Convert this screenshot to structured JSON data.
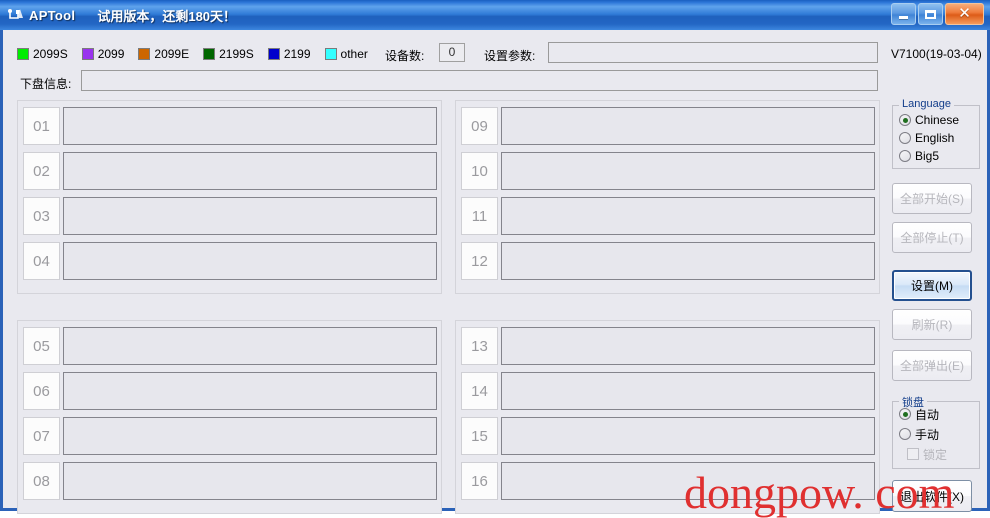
{
  "window": {
    "title": "APTool",
    "subtitle": "试用版本，还剩180天！",
    "icon": "usb-device-icon",
    "buttons": {
      "minimize": "minimize-button",
      "maximize": "maximize-button",
      "close": "close-button"
    }
  },
  "legend": {
    "items": [
      {
        "label": "2099S",
        "color": "#00ee00"
      },
      {
        "label": "2099",
        "color": "#9933ee"
      },
      {
        "label": "2099E",
        "color": "#cc6600"
      },
      {
        "label": "2199S",
        "color": "#006600"
      },
      {
        "label": "2199",
        "color": "#0000cc"
      },
      {
        "label": "other",
        "color": "#33ffff"
      }
    ]
  },
  "toolbar": {
    "device_count_label": "设备数:",
    "device_count_value": "0",
    "params_label": "设置参数:",
    "params_value": "",
    "params_placeholder": "",
    "version": "V7100(19-03-04)"
  },
  "diskinfo": {
    "label": "下盘信息:",
    "value": "",
    "placeholder": ""
  },
  "ports": {
    "top_left": [
      {
        "num": "01",
        "value": ""
      },
      {
        "num": "02",
        "value": ""
      },
      {
        "num": "03",
        "value": ""
      },
      {
        "num": "04",
        "value": ""
      }
    ],
    "top_right": [
      {
        "num": "09",
        "value": ""
      },
      {
        "num": "10",
        "value": ""
      },
      {
        "num": "11",
        "value": ""
      },
      {
        "num": "12",
        "value": ""
      }
    ],
    "bottom_left": [
      {
        "num": "05",
        "value": ""
      },
      {
        "num": "06",
        "value": ""
      },
      {
        "num": "07",
        "value": ""
      },
      {
        "num": "08",
        "value": ""
      }
    ],
    "bottom_right": [
      {
        "num": "13",
        "value": ""
      },
      {
        "num": "14",
        "value": ""
      },
      {
        "num": "15",
        "value": ""
      },
      {
        "num": "16",
        "value": ""
      }
    ]
  },
  "language": {
    "title": "Language",
    "options": [
      {
        "label": "Chinese",
        "selected": true
      },
      {
        "label": "English",
        "selected": false
      },
      {
        "label": "Big5",
        "selected": false
      }
    ]
  },
  "lock": {
    "title": "锁盘",
    "options": [
      {
        "label": "自动",
        "selected": true
      },
      {
        "label": "手动",
        "selected": false
      }
    ],
    "checkbox": {
      "label": "锁定",
      "checked": false,
      "enabled": false
    }
  },
  "buttons": {
    "start_all": {
      "label": "全部开始(S)",
      "enabled": false
    },
    "stop_all": {
      "label": "全部停止(T)",
      "enabled": false
    },
    "setting": {
      "label": "设置(M)",
      "enabled": true,
      "focused": true
    },
    "refresh": {
      "label": "刷新(R)",
      "enabled": false
    },
    "eject_all": {
      "label": "全部弹出(E)",
      "enabled": false
    },
    "exit": {
      "label": "退出软件(X)",
      "enabled": true
    }
  },
  "watermark": {
    "text": "dongpow. com",
    "color": "#e03030"
  }
}
